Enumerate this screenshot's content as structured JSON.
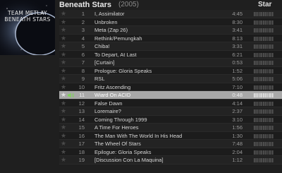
{
  "album": {
    "title": "Beneath Stars",
    "year": "(2005)",
    "cover_line1": "TEAM METLAY",
    "cover_line2": "BENEATH STARS"
  },
  "columns": {
    "star_label": "Star"
  },
  "tracks": [
    {
      "num": "1",
      "title": "I, Assimilator",
      "dur": "4:45"
    },
    {
      "num": "2",
      "title": "Unbroken",
      "dur": "8:30"
    },
    {
      "num": "3",
      "title": "Meta (Zap 26)",
      "dur": "3:41"
    },
    {
      "num": "4",
      "title": "Rethink/Pemungkah",
      "dur": "8:13"
    },
    {
      "num": "5",
      "title": "Chiba!",
      "dur": "3:31"
    },
    {
      "num": "6",
      "title": "To Depart, At Last",
      "dur": "6:21"
    },
    {
      "num": "7",
      "title": "[Curtain]",
      "dur": "0:53"
    },
    {
      "num": "8",
      "title": "Prologue: Gloria Speaks",
      "dur": "1:52"
    },
    {
      "num": "9",
      "title": "RSL",
      "dur": "5:06"
    },
    {
      "num": "10",
      "title": "Fritz Ascending",
      "dur": "7:10"
    },
    {
      "num": "11",
      "title": "Wiard On ACID",
      "dur": "0:48"
    },
    {
      "num": "12",
      "title": "False Dawn",
      "dur": "4:14"
    },
    {
      "num": "13",
      "title": "Loremaire?",
      "dur": "2:37"
    },
    {
      "num": "14",
      "title": "Coming Through 1999",
      "dur": "3:10"
    },
    {
      "num": "15",
      "title": "A Time For Heroes",
      "dur": "1:56"
    },
    {
      "num": "16",
      "title": "The Man With The World In His Head",
      "dur": "1:30"
    },
    {
      "num": "17",
      "title": "The Wheel Of Stars",
      "dur": "7:48"
    },
    {
      "num": "18",
      "title": "Epilogue: Gloria Speaks",
      "dur": "2:04"
    },
    {
      "num": "19",
      "title": "[Discussion Con La Maquina]",
      "dur": "1:12"
    }
  ],
  "selected_index": 10,
  "colors": {
    "selected_bg": "#a8a8a8",
    "background": "#1f1f1f",
    "speaker_green": "#7fd35a"
  }
}
